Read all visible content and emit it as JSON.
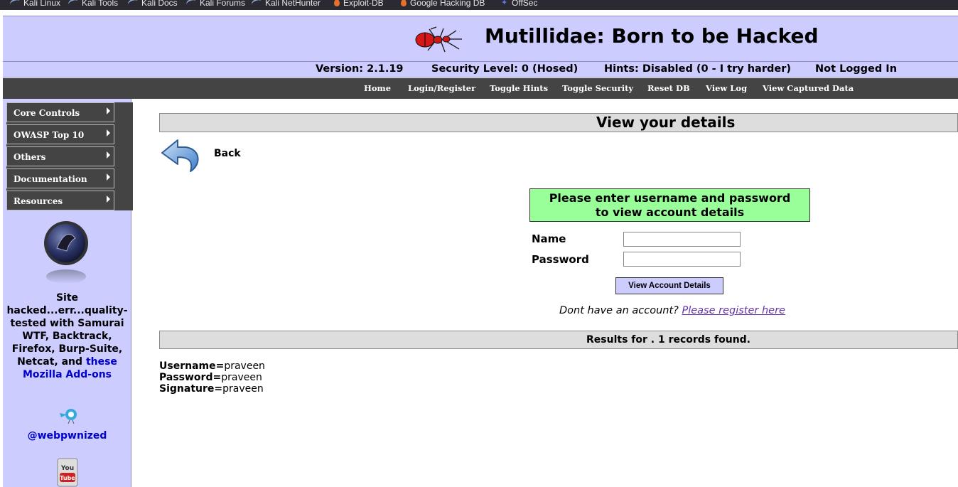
{
  "bookmarks": [
    {
      "label": "Kali Linux",
      "icon": "kali-dragon-icon"
    },
    {
      "label": "Kali Tools",
      "icon": "kali-dragon-icon"
    },
    {
      "label": "Kali Docs",
      "icon": "kali-dragon-icon"
    },
    {
      "label": "Kali Forums",
      "icon": "kali-dragon-icon"
    },
    {
      "label": "Kali NetHunter",
      "icon": "kali-dragon-icon"
    },
    {
      "label": "Exploit-DB",
      "icon": "exploit-db-flame-icon"
    },
    {
      "label": "Google Hacking DB",
      "icon": "exploit-db-flame-icon"
    },
    {
      "label": "OffSec",
      "icon": "offsec-icon"
    }
  ],
  "header": {
    "title": "Mutillidae: Born to be Hacked",
    "version": "Version: 2.1.19",
    "security": "Security Level: 0 (Hosed)",
    "hints": "Hints: Disabled (0 - I try harder)",
    "login_status": "Not Logged In"
  },
  "nav": {
    "home": "Home",
    "login": "Login/Register",
    "toggle_hints": "Toggle Hints",
    "toggle_security": "Toggle Security",
    "reset_db": "Reset DB",
    "view_log": "View Log",
    "view_captured": "View Captured Data"
  },
  "sidebar": {
    "menu": [
      "Core Controls",
      "OWASP Top 10",
      "Others",
      "Documentation",
      "Resources"
    ],
    "blurb": "Site hacked...err...quality-tested with Samurai WTF, Backtrack, Firefox, Burp-Suite, Netcat, and",
    "blurb_link": "these Mozilla Add-ons",
    "twitter_handle": "@webpwnized"
  },
  "main": {
    "page_title": "View your details",
    "back_label": "Back",
    "prompt_line1": "Please enter username and password",
    "prompt_line2": "to view account details",
    "name_label": "Name",
    "password_label": "Password",
    "name_value": "",
    "password_value": "",
    "submit_label": "View Account Details",
    "register_text": "Dont have an account?",
    "register_link": "Please register here",
    "results_title": "Results for . 1 records found.",
    "record": {
      "username_label": "Username=",
      "username": "praveen",
      "password_label": "Password=",
      "password": "praveen",
      "signature_label": "Signature=",
      "signature": "praveen"
    }
  },
  "colors": {
    "header_bg": "#ccccff",
    "nav_bg": "#444444",
    "prompt_bg": "#99ff99",
    "title_bar_bg": "#dddddd",
    "link": "#0000cc"
  }
}
